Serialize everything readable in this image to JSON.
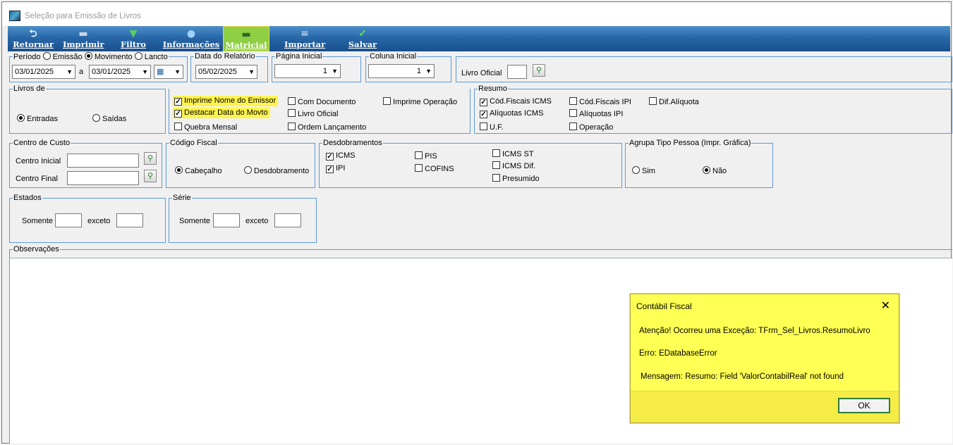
{
  "window": {
    "title": "Seleção para Emissão de Livros"
  },
  "toolbar": {
    "buttons": [
      {
        "label": "Retornar",
        "icon": "return-icon"
      },
      {
        "label": "Imprimir",
        "icon": "printer-icon"
      },
      {
        "label": "Filtro",
        "icon": "filter-icon"
      },
      {
        "label": "Informações",
        "icon": "info-icon"
      },
      {
        "label": "Matricial",
        "icon": "dot-matrix-printer-icon"
      },
      {
        "label": "Importar",
        "icon": "import-icon"
      },
      {
        "label": "Salvar",
        "icon": "checkmark-icon"
      }
    ]
  },
  "periodo": {
    "title": "Período",
    "opt_emissao": "Emissão",
    "opt_movimento": "Movimento",
    "opt_lancto": "Lancto",
    "selected": "Movimento",
    "date_from": "03/01/2025",
    "date_sep": "a",
    "date_to": "03/01/2025"
  },
  "data_relatorio": {
    "title": "Data do Relatório",
    "value": "05/02/2025"
  },
  "pagina_inicial": {
    "title": "Página Inicial",
    "value": "1"
  },
  "coluna_inicial": {
    "title": "Coluna Inicial",
    "value": "1"
  },
  "livro_oficial": {
    "label": "Livro Oficial",
    "value": ""
  },
  "livros_de": {
    "title": "Livros de",
    "opt_entradas": "Entradas",
    "opt_saidas": "Saídas",
    "selected": "Entradas"
  },
  "opcoes": {
    "imprime_nome_emissor": "Imprime Nome do Emissor",
    "destacar_data_movto": "Destacar Data do Movto",
    "quebra_mensal": "Quebra Mensal",
    "com_documento": "Com Documento",
    "livro_oficial": "Livro Oficial",
    "ordem_lancamento": "Ordem Lançamento",
    "imprime_operacao": "Imprime Operação"
  },
  "resumo": {
    "title": "Resumo",
    "cod_fiscais_icms": "Cód.Fiscais ICMS",
    "aliquotas_icms": "Alíquotas ICMS",
    "uf": "U.F.",
    "cod_fiscais_ipi": "Cód.Fiscais IPI",
    "aliquotas_ipi": "Alíquotas IPI",
    "operacao": "Operação",
    "dif_aliquota": "Dif.Alíquota"
  },
  "centro_custo": {
    "title": "Centro de Custo",
    "inicial": "Centro Inicial",
    "final": "Centro Final"
  },
  "codigo_fiscal": {
    "title": "Código Fiscal",
    "opt_cabecalho": "Cabeçalho",
    "opt_desdobramento": "Desdobramento",
    "selected": "Cabeçalho"
  },
  "desdobramentos": {
    "title": "Desdobramentos",
    "icms": "ICMS",
    "ipi": "IPI",
    "pis": "PIS",
    "cofins": "COFINS",
    "icms_st": "ICMS ST",
    "icms_dif": "ICMS Dif.",
    "presumido": "Presumido"
  },
  "agrupa": {
    "title": "Agrupa Tipo Pessoa (Impr. Gráfica)",
    "opt_sim": "Sim",
    "opt_nao": "Não",
    "selected": "Não"
  },
  "estados": {
    "title": "Estados",
    "somente": "Somente",
    "exceto": "exceto"
  },
  "serie": {
    "title": "Série",
    "somente": "Somente",
    "exceto": "exceto"
  },
  "observacoes": {
    "title": "Observações"
  },
  "dialog": {
    "title": "Contábil Fiscal",
    "close": "✕",
    "line1": "Atenção! Ocorreu uma Exceção: TFrm_Sel_Livros.ResumoLivro",
    "line2": "Erro: EDatabaseError",
    "line3": "Mensagem: Resumo: Field 'ValorContabilReal' not found",
    "ok": "OK"
  },
  "colors": {
    "toolbar": "#2867a8",
    "group_border": "#5d9bd4",
    "highlight": "#fff44d",
    "dialog_bg": "#ffff54"
  }
}
